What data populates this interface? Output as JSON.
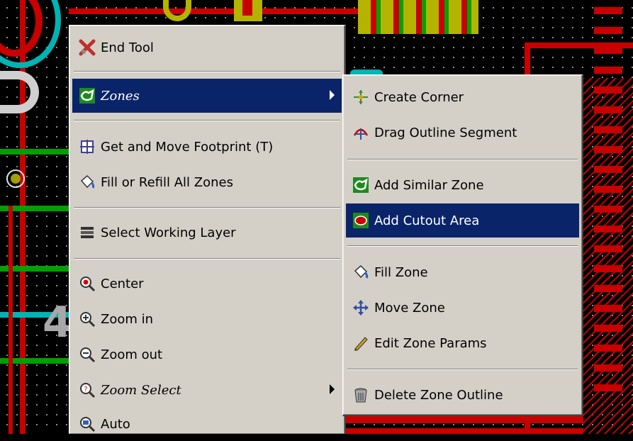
{
  "main_menu": {
    "items": [
      {
        "label": "End Tool",
        "icon": "end-tool-icon"
      },
      {
        "label": "Zones",
        "icon": "zone-icon",
        "submenu": true,
        "highlighted": true
      },
      {
        "label": "Get and Move Footprint (T)",
        "icon": "move-footprint-icon"
      },
      {
        "label": "Fill or Refill All Zones",
        "icon": "fill-bucket-icon"
      },
      {
        "label": "Select Working Layer",
        "icon": "layers-icon"
      },
      {
        "label": "Center",
        "icon": "zoom-center-icon"
      },
      {
        "label": "Zoom in",
        "icon": "zoom-in-icon"
      },
      {
        "label": "Zoom out",
        "icon": "zoom-out-icon"
      },
      {
        "label": "Zoom Select",
        "icon": "zoom-select-icon",
        "submenu": true
      },
      {
        "label": "Auto",
        "icon": "zoom-auto-icon"
      }
    ]
  },
  "zones_submenu": {
    "items": [
      {
        "label": "Create Corner",
        "icon": "create-corner-icon"
      },
      {
        "label": "Drag Outline Segment",
        "icon": "drag-segment-icon"
      },
      {
        "label": "Add Similar Zone",
        "icon": "add-zone-icon"
      },
      {
        "label": "Add Cutout Area",
        "icon": "add-cutout-icon",
        "highlighted": true
      },
      {
        "label": "Fill Zone",
        "icon": "fill-bucket-icon"
      },
      {
        "label": "Move Zone",
        "icon": "move-arrows-icon"
      },
      {
        "label": "Edit Zone Params",
        "icon": "pencil-icon"
      },
      {
        "label": "Delete Zone Outline",
        "icon": "trash-can-icon"
      }
    ]
  },
  "colors": {
    "menu_bg": "#d4d0c8",
    "highlight": "#0a246a",
    "pcb_bg": "#000000",
    "track_red": "#c80000",
    "track_green": "#00a000",
    "pad_cyan": "#00b4b4",
    "silk_yellow": "#b4b400"
  }
}
